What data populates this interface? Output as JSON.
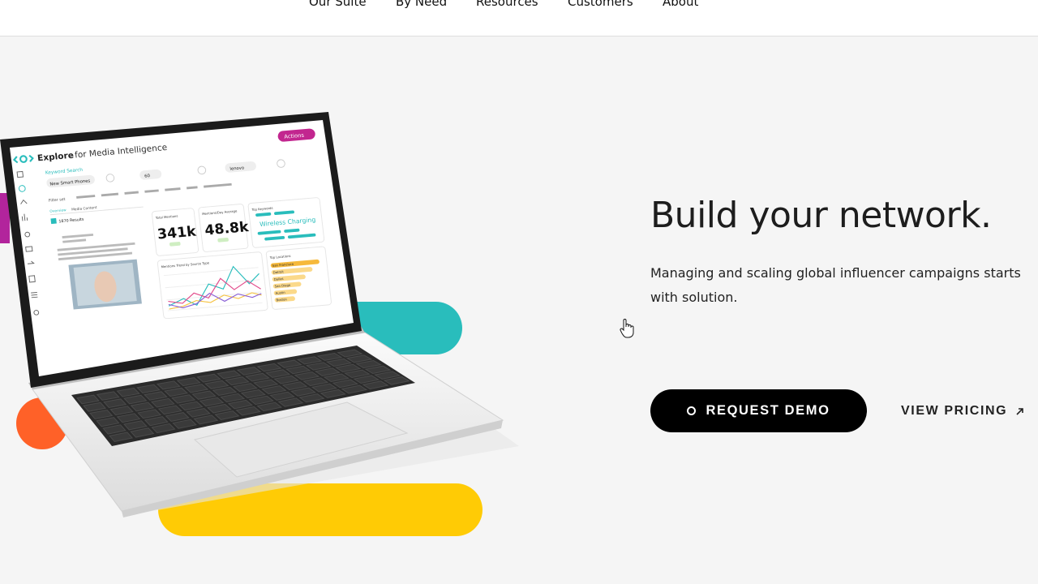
{
  "nav": {
    "items": [
      {
        "label": "Our Suite"
      },
      {
        "label": "By Need"
      },
      {
        "label": "Resources"
      },
      {
        "label": "Customers"
      },
      {
        "label": "About"
      }
    ]
  },
  "laptop_screen": {
    "brand": "Explore",
    "product": "for Media Intelligence",
    "actions_label": "Actions",
    "keyword_search_label": "Keyword Search",
    "query_value": "New Smart Phones",
    "days_value": "60",
    "brand_value": "lenovo",
    "filter_label": "Filter set",
    "tabs": [
      "Overview",
      "Media Content"
    ],
    "results_label": "1870 Results",
    "total_mentions_label": "Total Mentions",
    "total_mentions_value": "341k",
    "daily_average_label": "Mentions/Day Average",
    "daily_average_value": "48.8k",
    "top_keywords_label": "Top Keywords",
    "top_keyword": "Wireless Charging",
    "trend_label": "Mentions Trend by Source Type",
    "top_locations_label": "Top Locations",
    "locations": [
      "San Francisco",
      "Detroit",
      "Dallas",
      "San Diego",
      "Austin",
      "Boston"
    ],
    "location_values": [
      0.95,
      0.8,
      0.65,
      0.55,
      0.45,
      0.4
    ]
  },
  "hero": {
    "title": "Build your network.",
    "subtitle": "Managing and scaling global influencer campaigns starts with solution."
  },
  "cta": {
    "primary_label": "REQUEST DEMO",
    "secondary_label": "VIEW PRICING"
  },
  "colors": {
    "teal": "#29bdbc",
    "yellow": "#ffcb05",
    "orange": "#ff6128",
    "magenta": "#b2249c",
    "black": "#000000"
  }
}
